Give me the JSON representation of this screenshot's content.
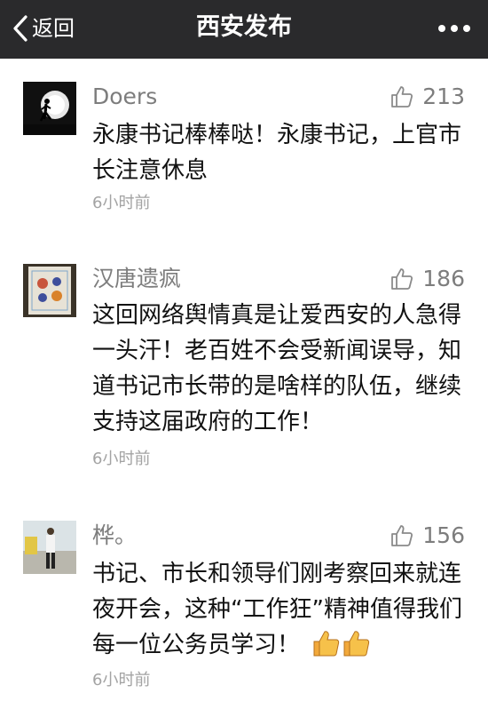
{
  "nav": {
    "back_label": "返回",
    "title": "西安发布",
    "back_icon": "chevron-left-icon",
    "more_icon": "more-dots-icon"
  },
  "comments": [
    {
      "author": "Doers",
      "likes": "213",
      "text": "永康书记棒棒哒！永康书记，上官市长注意休息",
      "time": "6小时前",
      "avatar": "silhouette-runner-moon"
    },
    {
      "author": "汉唐遗疯",
      "likes": "186",
      "text": "这回网络舆情真是让爱西安的人急得一头汗！老百姓不会受新闻误导，知道书记市长带的是啥样的队伍，继续支持这届政府的工作！",
      "time": "6小时前",
      "avatar": "drawing-paper"
    },
    {
      "author": "桦。",
      "likes": "156",
      "text": "书记、市长和领导们刚考察回来就连夜开会，这种“工作狂”精神值得我们每一位公务员学习！",
      "time": "6小时前",
      "avatar": "person-standing-photo",
      "emoji": "thumbs-up-emoji"
    }
  ],
  "like_icon": "thumbs-up-outline-icon",
  "colors": {
    "nav_bg": "#2a2a2c",
    "meta_gray": "#7d7d7d",
    "time_gray": "#a3a3a3"
  }
}
